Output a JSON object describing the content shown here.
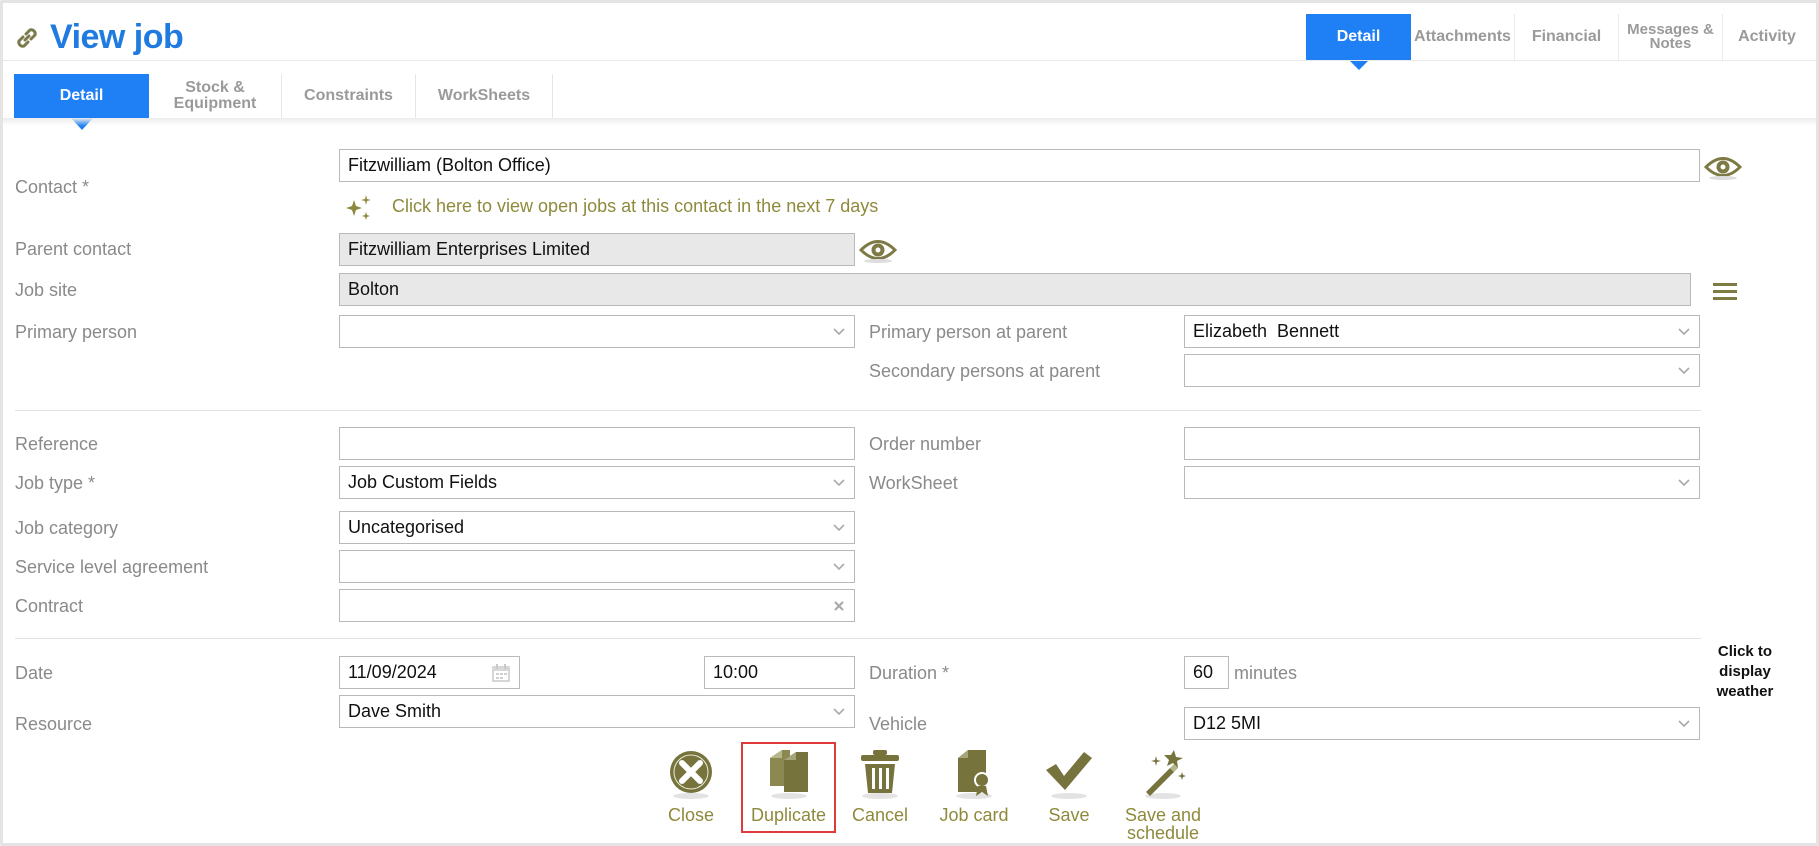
{
  "header": {
    "title": "View job",
    "tabs": [
      {
        "label": "Detail",
        "active": true
      },
      {
        "label": "Attachments",
        "active": false
      },
      {
        "label": "Financial",
        "active": false
      },
      {
        "label": "Messages & Notes",
        "active": false
      },
      {
        "label": "Activity",
        "active": false
      }
    ]
  },
  "subtabs": [
    {
      "label": "Detail",
      "active": true
    },
    {
      "label": "Stock & Equipment",
      "active": false
    },
    {
      "label": "Constraints",
      "active": false
    },
    {
      "label": "WorkSheets",
      "active": false
    }
  ],
  "form": {
    "contact": {
      "label": "Contact *",
      "value": "Fitzwilliam (Bolton Office)"
    },
    "open_jobs_link": "Click here to view open jobs at this contact in the next 7 days",
    "parent_contact": {
      "label": "Parent contact",
      "value": "Fitzwilliam Enterprises Limited"
    },
    "job_site": {
      "label": "Job site",
      "value": "Bolton"
    },
    "primary_person": {
      "label": "Primary person",
      "value": ""
    },
    "primary_person_parent": {
      "label": "Primary person at parent",
      "value": "Elizabeth  Bennett"
    },
    "secondary_persons_parent": {
      "label": "Secondary persons at parent",
      "value": ""
    },
    "reference": {
      "label": "Reference",
      "value": ""
    },
    "order_number": {
      "label": "Order number",
      "value": ""
    },
    "job_type": {
      "label": "Job type *",
      "value": "Job Custom Fields"
    },
    "worksheet": {
      "label": "WorkSheet",
      "value": ""
    },
    "job_category": {
      "label": "Job category",
      "value": "Uncategorised"
    },
    "sla": {
      "label": "Service level agreement",
      "value": ""
    },
    "contract": {
      "label": "Contract",
      "value": ""
    },
    "date": {
      "label": "Date",
      "value": "11/09/2024",
      "time": "10:00"
    },
    "duration": {
      "label": "Duration *",
      "value": "60",
      "unit": "minutes"
    },
    "resource": {
      "label": "Resource",
      "value": "Dave Smith"
    },
    "vehicle": {
      "label": "Vehicle",
      "value": "D12 5MI"
    },
    "weather_link": "Click to display weather"
  },
  "toolbar": {
    "close": "Close",
    "duplicate": "Duplicate",
    "cancel": "Cancel",
    "job_card": "Job card",
    "save": "Save",
    "save_schedule": "Save and schedule"
  },
  "colors": {
    "accent": "#1f7ff5",
    "title": "#1f7be0",
    "olive": "#8e8a3c",
    "highlight": "#e03a3a"
  }
}
